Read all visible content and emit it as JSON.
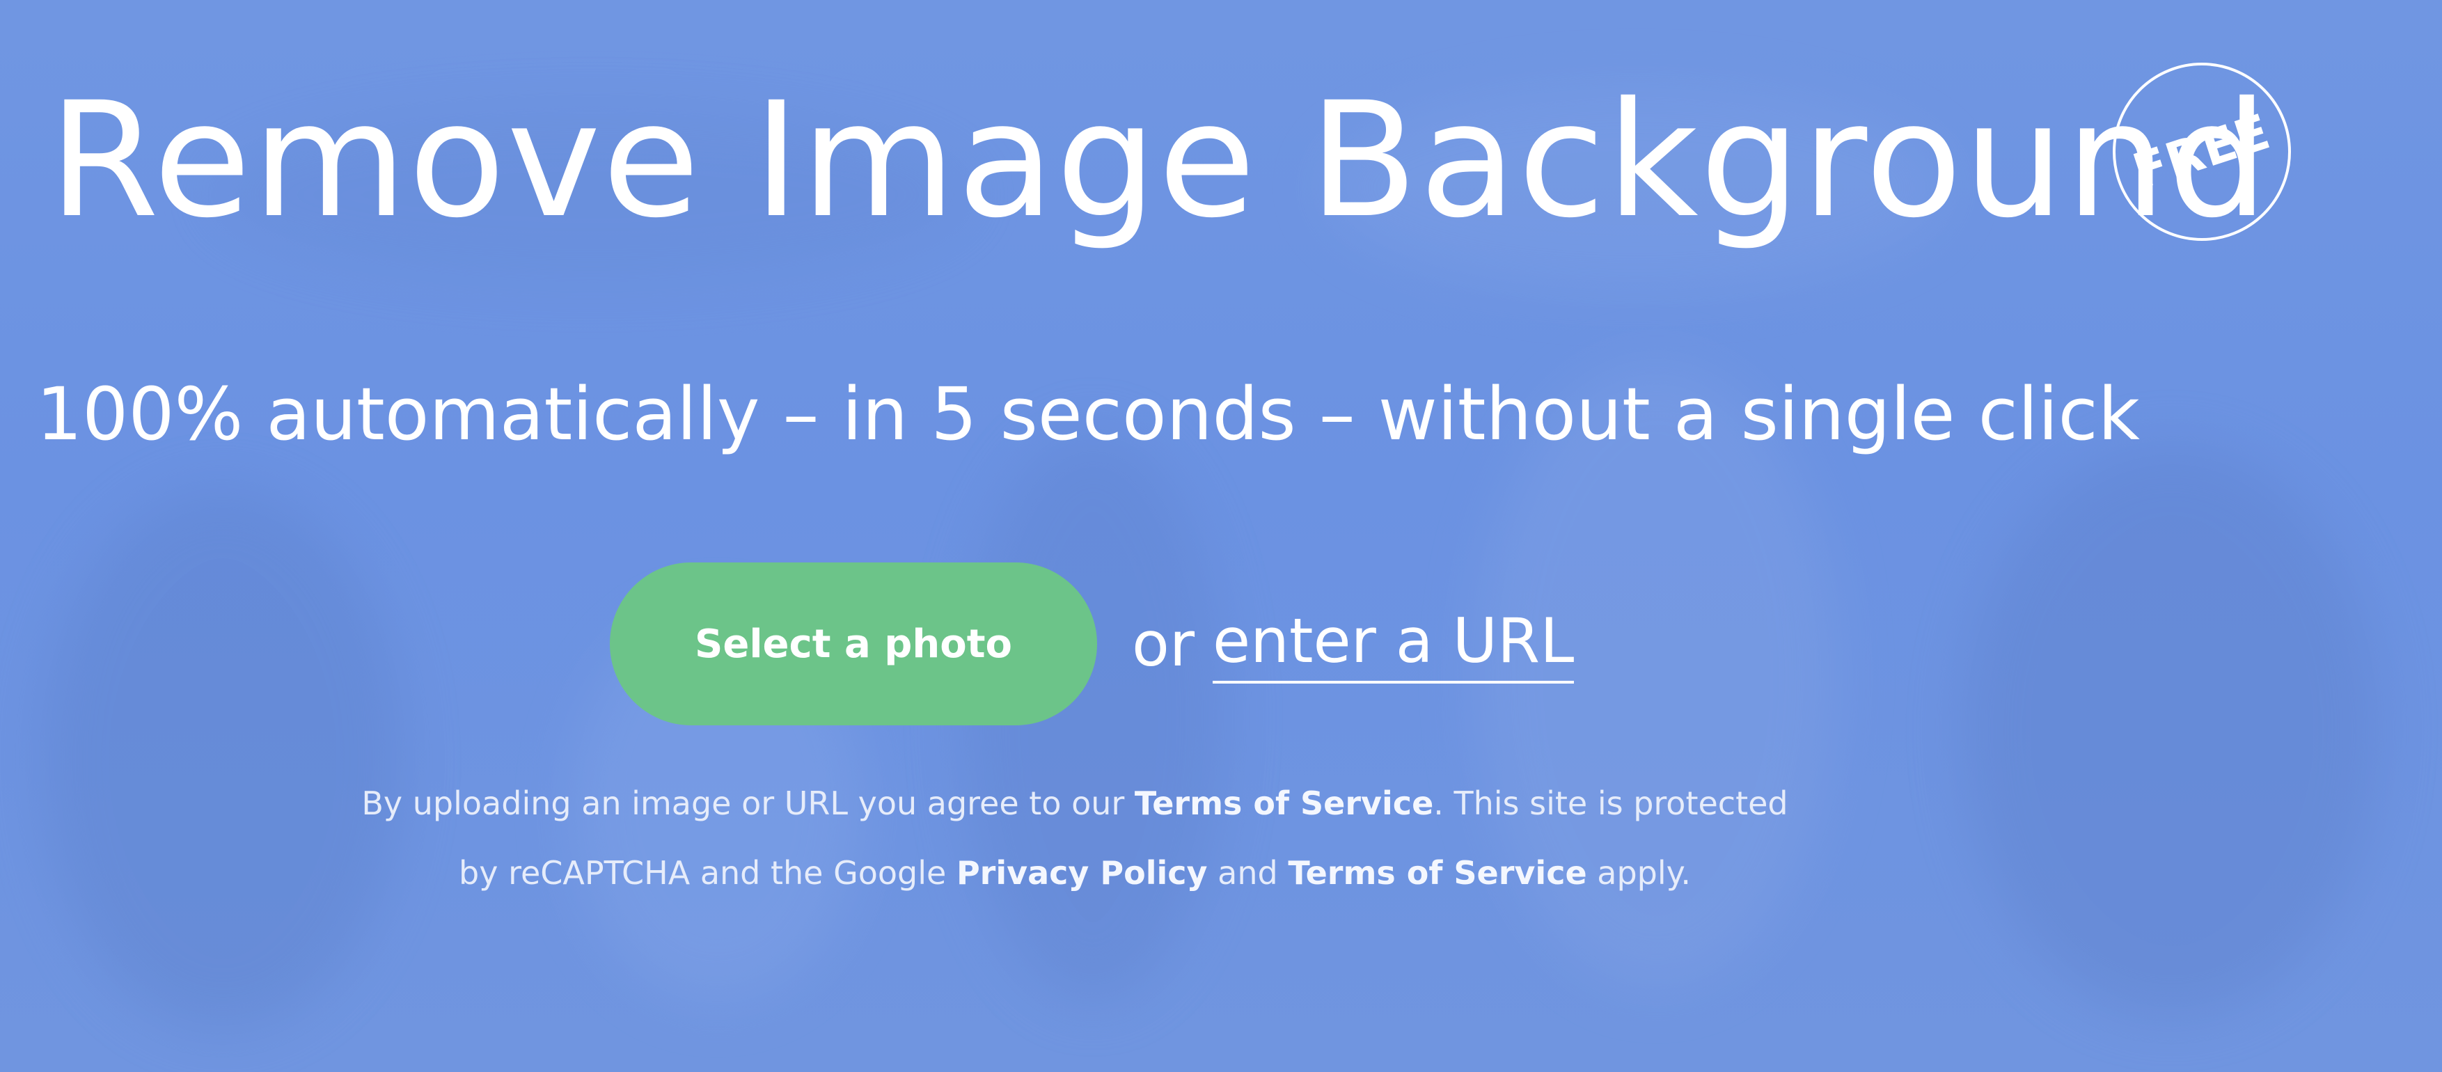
{
  "colors": {
    "background": "#6c93e2",
    "button": "#6cc489",
    "text": "#ffffff"
  },
  "hero": {
    "title": "Remove Image Background",
    "badge": "FREE",
    "subtitle": "100% automatically – in 5 seconds – without a single click"
  },
  "cta": {
    "select_label": "Select a photo",
    "or_text": "or",
    "url_label": "enter a URL"
  },
  "legal": {
    "line1_prefix": "By uploading an image or URL you agree to our",
    "terms_link_1": "Terms of Service",
    "line1_suffix": ". This site is protected",
    "line2_prefix": "by reCAPTCHA and the Google",
    "privacy_link": "Privacy Policy",
    "and_text": "and",
    "terms_link_2": "Terms of Service",
    "line2_suffix": "apply."
  }
}
